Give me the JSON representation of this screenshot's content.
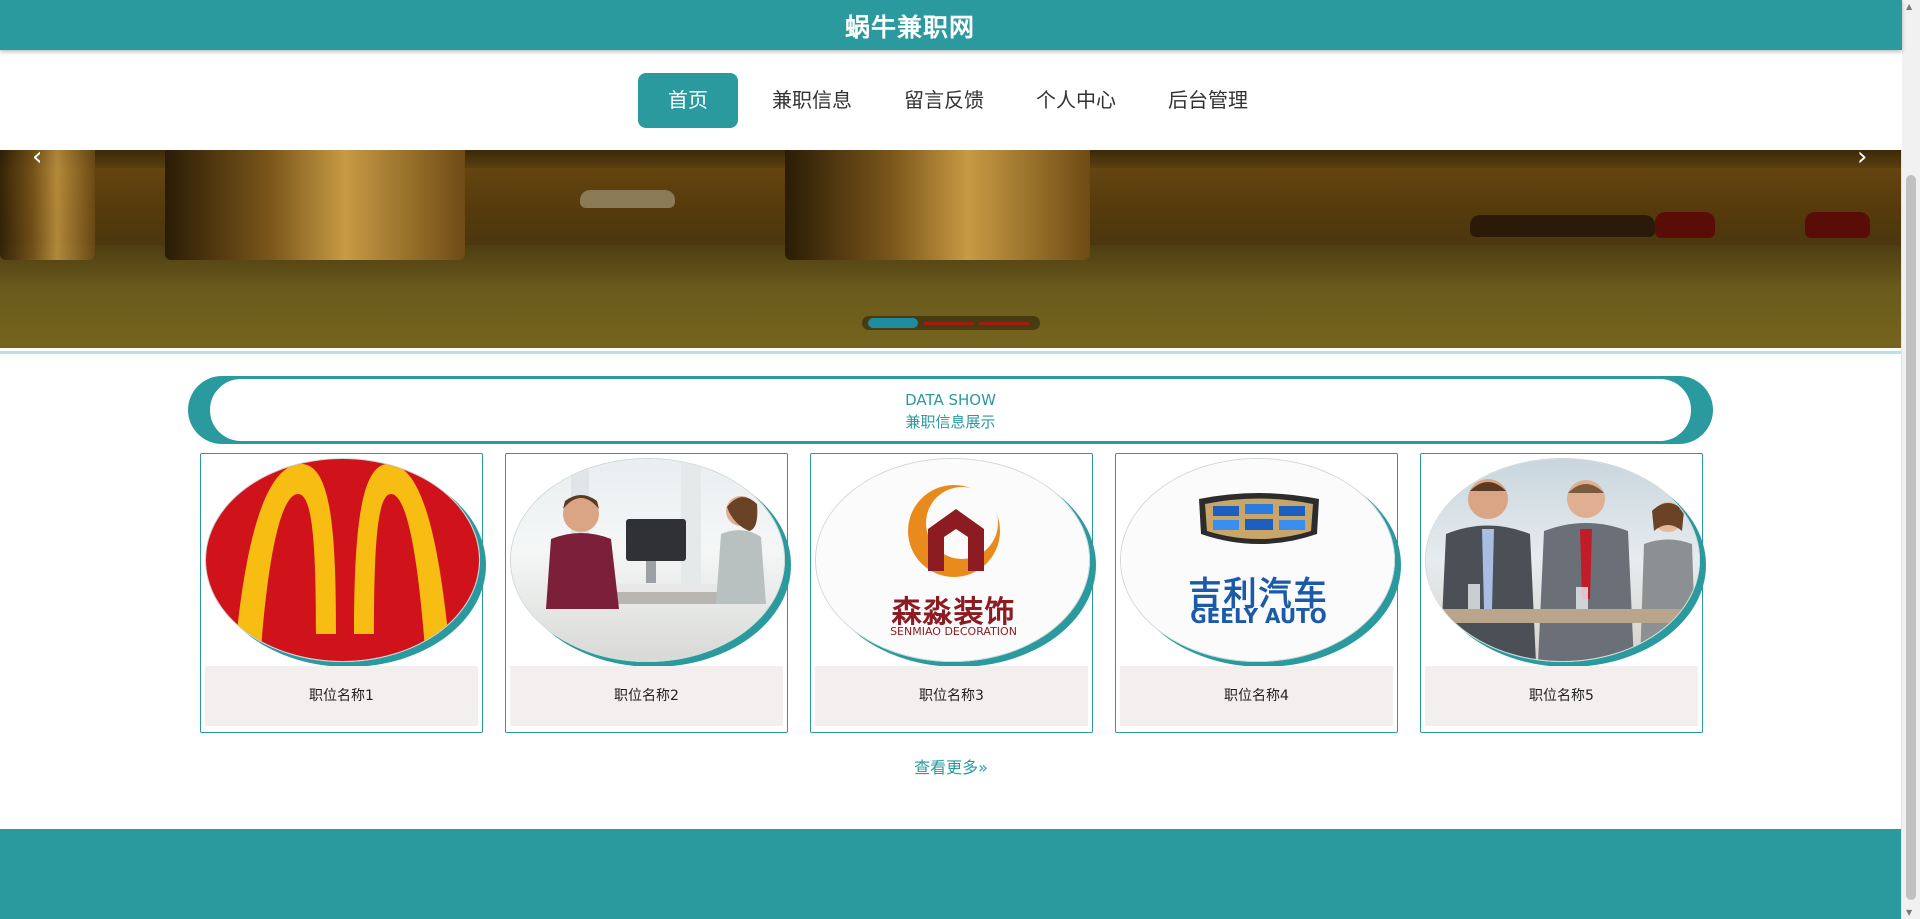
{
  "header": {
    "site_title": "蜗牛兼职网"
  },
  "nav": {
    "items": [
      {
        "label": "首页",
        "active": true
      },
      {
        "label": "兼职信息",
        "active": false
      },
      {
        "label": "留言反馈",
        "active": false
      },
      {
        "label": "个人中心",
        "active": false
      },
      {
        "label": "后台管理",
        "active": false
      }
    ]
  },
  "banner": {
    "prev_icon": "‹",
    "next_icon": "›",
    "slide_count": 3,
    "active_slide": 1
  },
  "section": {
    "title_en": "DATA SHOW",
    "title_zh": "兼职信息展示"
  },
  "jobs": [
    {
      "name": "职位名称1",
      "image": "mcdonalds-logo"
    },
    {
      "name": "职位名称2",
      "image": "office-meeting-photo"
    },
    {
      "name": "职位名称3",
      "image": "senmiao-decoration-logo",
      "logo_text_zh": "森淼装饰",
      "logo_text_en": "SENMIAO DECORATION"
    },
    {
      "name": "职位名称4",
      "image": "geely-auto-logo",
      "logo_text_zh": "吉利汽车",
      "logo_text_en": "GEELY AUTO"
    },
    {
      "name": "职位名称5",
      "image": "business-people-photo"
    }
  ],
  "more_link": "查看更多»",
  "colors": {
    "primary": "#2a9a9f",
    "card_label_bg": "#f4efef"
  }
}
